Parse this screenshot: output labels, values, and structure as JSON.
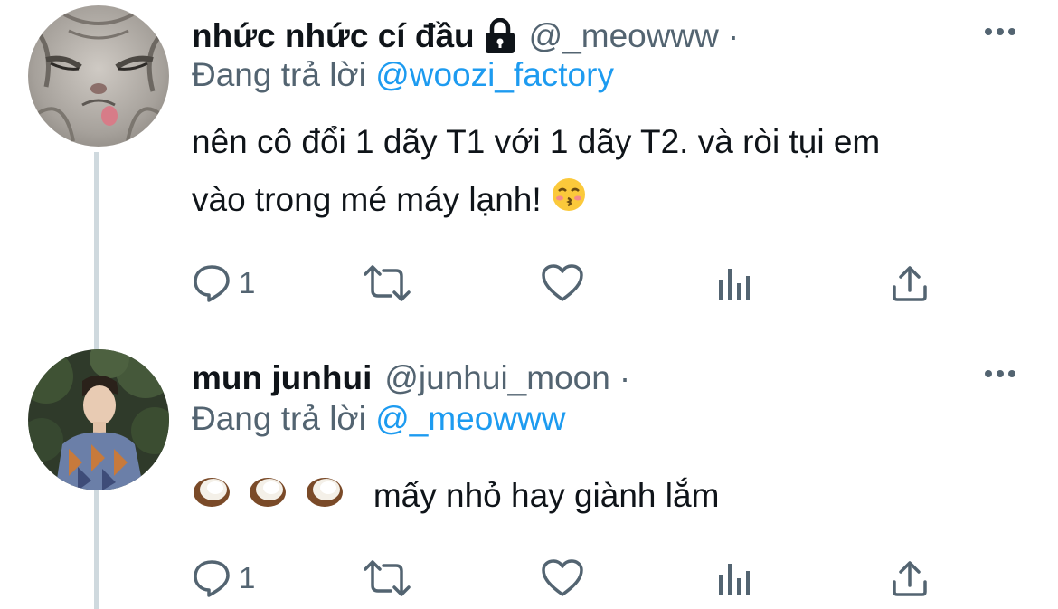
{
  "tweets": [
    {
      "display_name": "nhức nhức cí đầu",
      "locked": true,
      "handle": "@_meowww",
      "separator": "·",
      "reply_prefix": "Đang trả lời",
      "reply_to": "@woozi_factory",
      "text_line1": "nên cô đổi 1 dãy T1 với 1 dãy T2. và ròi tụi em",
      "text_line2": "vào trong mé máy lạnh!",
      "emoji": "kissing-face-with-closed-eyes",
      "reply_count": "1",
      "avatar": "cat-photo"
    },
    {
      "display_name": "mun junhui",
      "locked": false,
      "handle": "@junhui_moon",
      "separator": "·",
      "reply_prefix": "Đang trả lời",
      "reply_to": "@_meowww",
      "text": "mấy nhỏ hay giành lắm",
      "emoji": "coconut",
      "reply_count": "1",
      "avatar": "person-photo"
    }
  ],
  "colors": {
    "primary_text": "#0f1419",
    "secondary_text": "#536471",
    "link": "#1d9bf0",
    "thread_line": "#cfd9de"
  }
}
